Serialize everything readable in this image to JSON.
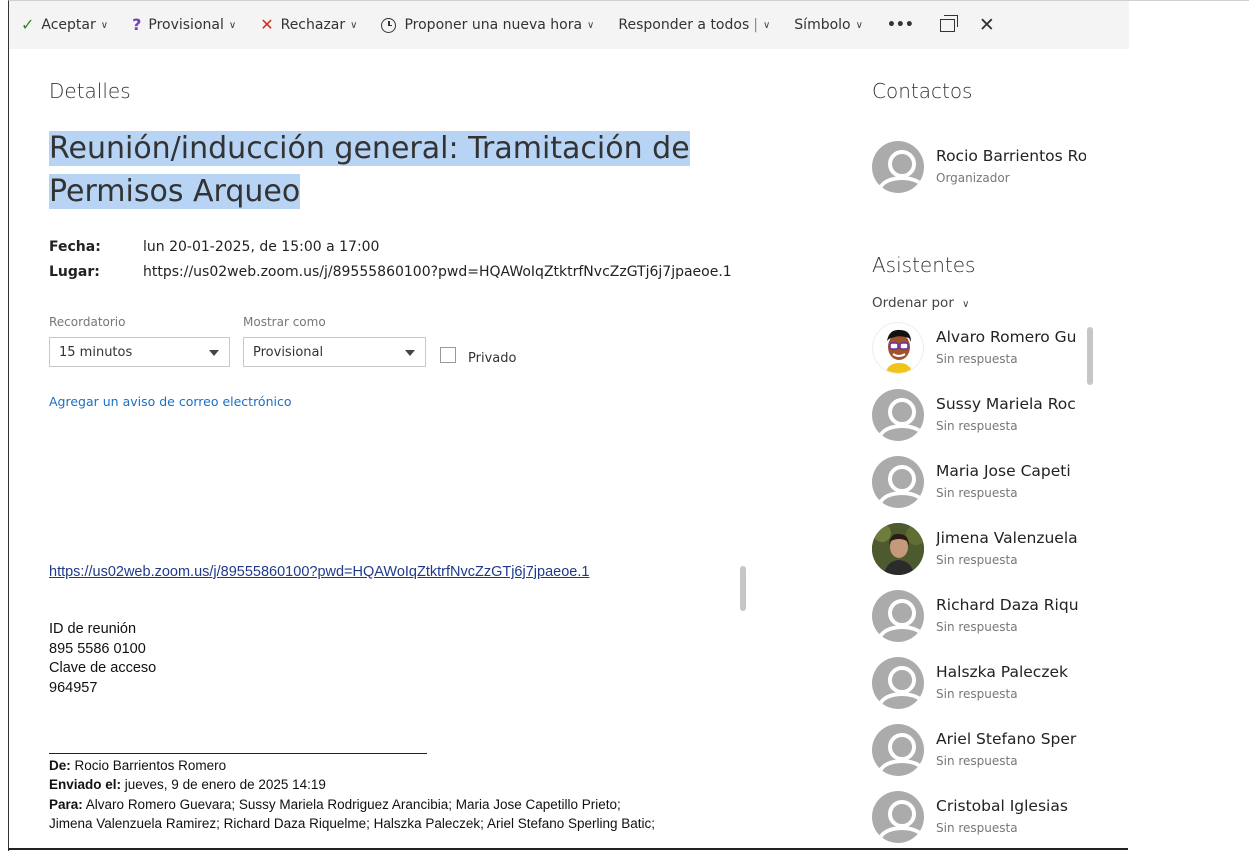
{
  "toolbar": {
    "accept": "Aceptar",
    "tentative": "Provisional",
    "decline": "Rechazar",
    "propose": "Proponer una nueva hora",
    "reply_all": "Responder a todos",
    "symbol": "Símbolo",
    "more": "•••"
  },
  "details": {
    "title": "Detalles",
    "subject": "Reunión/inducción general: Tramitación de Permisos Arqueo",
    "date_label": "Fecha:",
    "date_value": "lun 20-01-2025, de 15:00 a 17:00",
    "location_label": "Lugar:",
    "location_value": "https://us02web.zoom.us/j/89555860100?pwd=HQAWoIqZtktrfNvcZzGTj6j7jpaeoe.1",
    "reminder_label": "Recordatorio",
    "reminder_value": "15 minutos",
    "show_as_label": "Mostrar como",
    "show_as_value": "Provisional",
    "private_label": "Privado",
    "add_email_reminder": "Agregar un aviso de correo electrónico"
  },
  "body": {
    "link": "https://us02web.zoom.us/j/89555860100?pwd=HQAWoIqZtktrfNvcZzGTj6j7jpaeoe.1",
    "meeting_id_label": "ID de reunión",
    "meeting_id": "895 5586 0100",
    "passcode_label": "Clave de acceso",
    "passcode": "964957",
    "from_label": "De:",
    "from_value": "Rocio Barrientos Romero",
    "sent_label": "Enviado el:",
    "sent_value": "jueves, 9 de enero de 2025 14:19",
    "to_label": "Para:",
    "to_value_line1": "Alvaro Romero Guevara; Sussy Mariela Rodriguez Arancibia; Maria Jose Capetillo Prieto;",
    "to_value_line2": "Jimena Valenzuela Ramirez; Richard Daza Riquelme; Halszka Paleczek; Ariel Stefano Sperling Batic;"
  },
  "contacts": {
    "title": "Contactos",
    "organizer_name": "Rocio Barrientos Ror",
    "organizer_role": "Organizador",
    "attendees_title": "Asistentes",
    "sort_label": "Ordenar por",
    "attendees": [
      {
        "name": "Alvaro Romero Gu",
        "status": "Sin respuesta"
      },
      {
        "name": "Sussy Mariela Roc",
        "status": "Sin respuesta"
      },
      {
        "name": "Maria Jose Capeti",
        "status": "Sin respuesta"
      },
      {
        "name": "Jimena Valenzuela",
        "status": "Sin respuesta"
      },
      {
        "name": "Richard Daza Riqu",
        "status": "Sin respuesta"
      },
      {
        "name": "Halszka Paleczek",
        "status": "Sin respuesta"
      },
      {
        "name": "Ariel Stefano Sper",
        "status": "Sin respuesta"
      },
      {
        "name": "Cristobal Iglesias",
        "status": "Sin respuesta"
      }
    ]
  },
  "colors": {
    "accent_link": "#1a6fc4",
    "selection": "#b8d4f5",
    "accept_green": "#2e8b2e",
    "tentative_purple": "#7a3fb4",
    "decline_red": "#d22c1f"
  }
}
